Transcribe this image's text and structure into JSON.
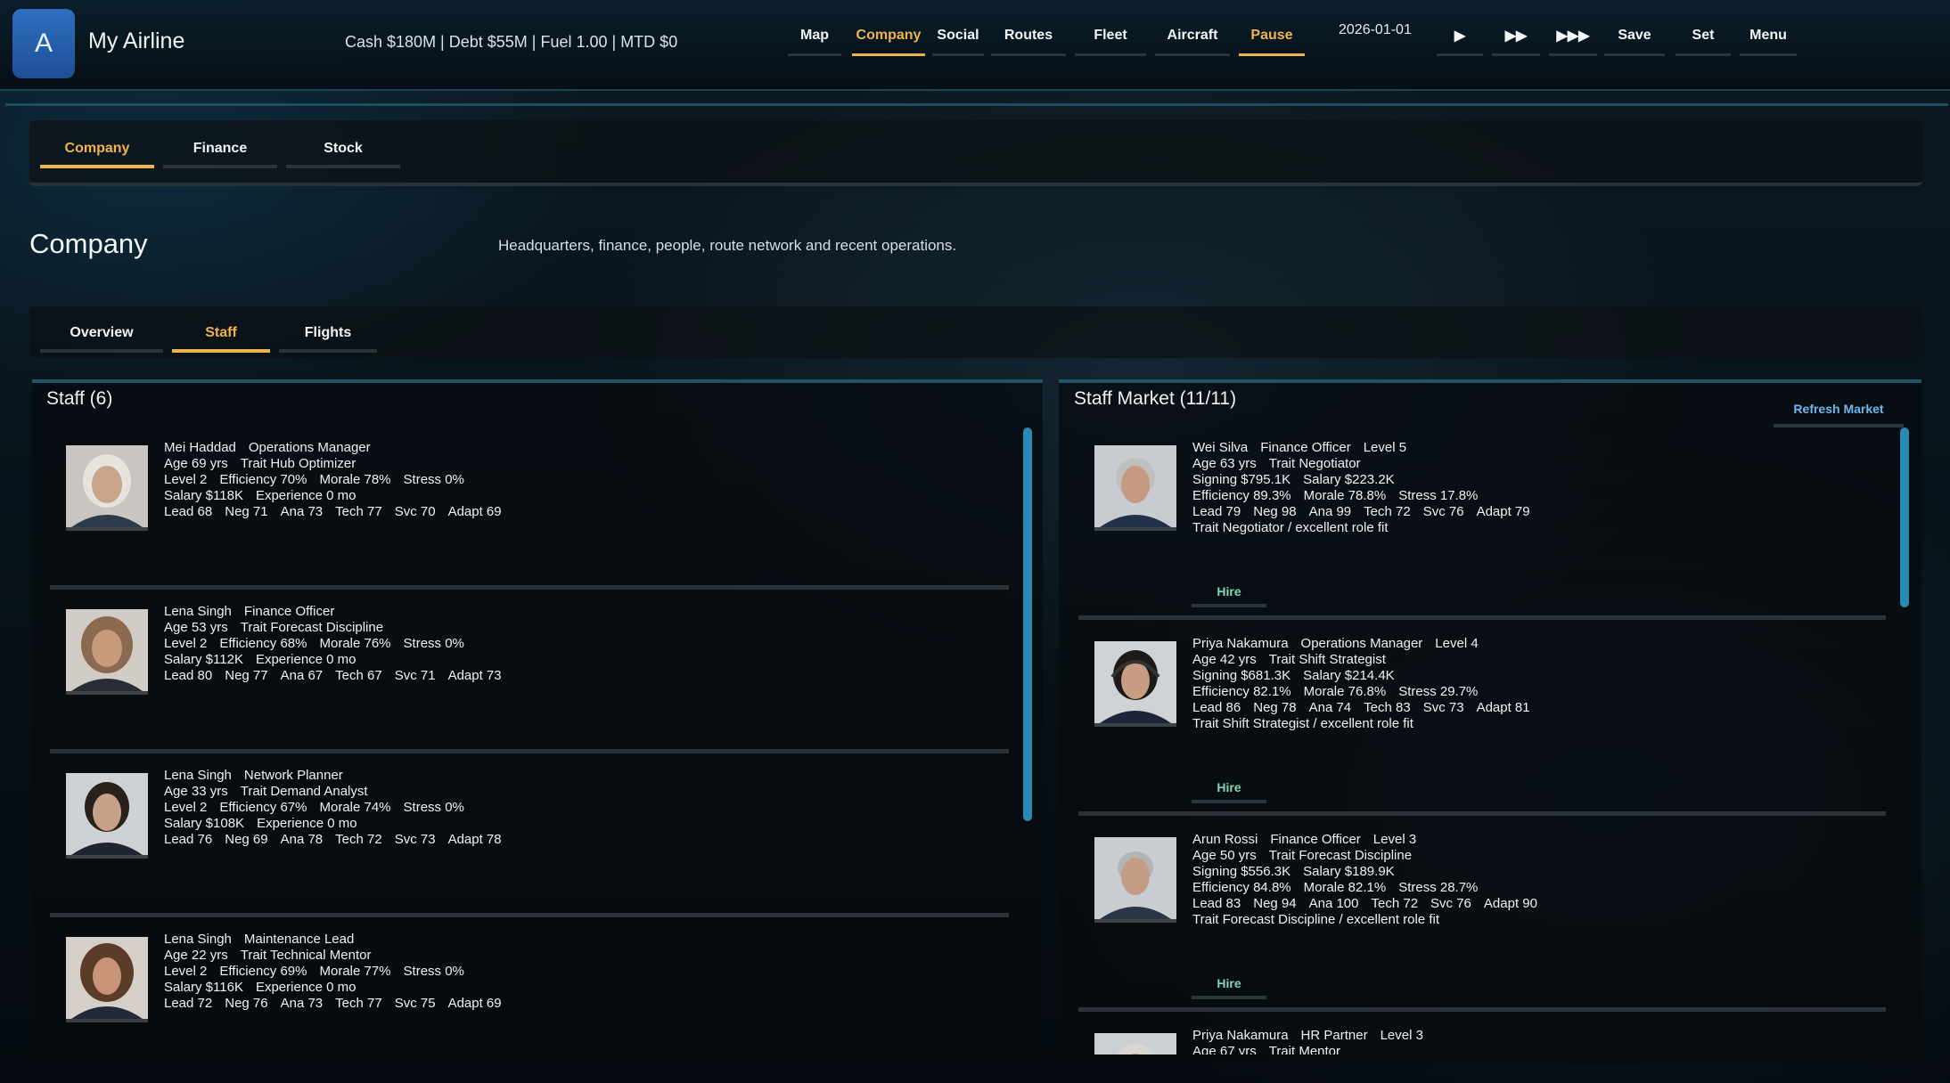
{
  "header": {
    "logo_letter": "A",
    "airline_name": "My Airline",
    "stats": "Cash $180M  |  Debt $55M  |  Fuel 1.00  |  MTD $0",
    "nav": [
      "Map",
      "Company",
      "Social",
      "Routes",
      "Fleet",
      "Aircraft",
      "Pause"
    ],
    "date": "2026-01-01",
    "controls": {
      "play": "▶",
      "fast": "▶▶",
      "fastest": "▶▶▶",
      "save": "Save",
      "set": "Set",
      "menu": "Menu"
    }
  },
  "section_tabs": [
    "Company",
    "Finance",
    "Stock"
  ],
  "page": {
    "title": "Company",
    "description": "Headquarters, finance, people, route network and recent operations."
  },
  "sub_tabs": [
    "Overview",
    "Staff",
    "Flights"
  ],
  "staff": {
    "title": "Staff (6)",
    "members": [
      {
        "name": "Mei Haddad",
        "role": "Operations Manager",
        "age": "Age 69 yrs",
        "trait": "Trait Hub Optimizer",
        "level": "Level 2",
        "efficiency": "Efficiency 70%",
        "morale": "Morale 78%",
        "stress": "Stress 0%",
        "salary": "Salary $118K",
        "experience": "Experience 0 mo",
        "skills": [
          "Lead 68",
          "Neg 71",
          "Ana 73",
          "Tech 77",
          "Svc 70",
          "Adapt 69"
        ]
      },
      {
        "name": "Lena Singh",
        "role": "Finance Officer",
        "age": "Age 53 yrs",
        "trait": "Trait Forecast Discipline",
        "level": "Level 2",
        "efficiency": "Efficiency 68%",
        "morale": "Morale 76%",
        "stress": "Stress 0%",
        "salary": "Salary $112K",
        "experience": "Experience 0 mo",
        "skills": [
          "Lead 80",
          "Neg 77",
          "Ana 67",
          "Tech 67",
          "Svc 71",
          "Adapt 73"
        ]
      },
      {
        "name": "Lena Singh",
        "role": "Network Planner",
        "age": "Age 33 yrs",
        "trait": "Trait Demand Analyst",
        "level": "Level 2",
        "efficiency": "Efficiency 67%",
        "morale": "Morale 74%",
        "stress": "Stress 0%",
        "salary": "Salary $108K",
        "experience": "Experience 0 mo",
        "skills": [
          "Lead 76",
          "Neg 69",
          "Ana 78",
          "Tech 72",
          "Svc 73",
          "Adapt 78"
        ]
      },
      {
        "name": "Lena Singh",
        "role": "Maintenance Lead",
        "age": "Age 22 yrs",
        "trait": "Trait Technical Mentor",
        "level": "Level 2",
        "efficiency": "Efficiency 69%",
        "morale": "Morale 77%",
        "stress": "Stress 0%",
        "salary": "Salary $116K",
        "experience": "Experience 0 mo",
        "skills": [
          "Lead 72",
          "Neg 76",
          "Ana 73",
          "Tech 77",
          "Svc 75",
          "Adapt 69"
        ]
      }
    ]
  },
  "market": {
    "title": "Staff Market (11/11)",
    "refresh_label": "Refresh Market",
    "hire_label": "Hire",
    "candidates": [
      {
        "name": "Wei Silva",
        "role": "Finance Officer",
        "level": "Level 5",
        "age": "Age 63 yrs",
        "trait": "Trait Negotiator",
        "signing": "Signing $795.1K",
        "salary": "Salary $223.2K",
        "efficiency": "Efficiency 89.3%",
        "morale": "Morale 78.8%",
        "stress": "Stress 17.8%",
        "skills": [
          "Lead 79",
          "Neg 98",
          "Ana 99",
          "Tech 72",
          "Svc 76",
          "Adapt 79"
        ],
        "fit": "Trait Negotiator / excellent role fit"
      },
      {
        "name": "Priya Nakamura",
        "role": "Operations Manager",
        "level": "Level 4",
        "age": "Age 42 yrs",
        "trait": "Trait Shift Strategist",
        "signing": "Signing $681.3K",
        "salary": "Salary $214.4K",
        "efficiency": "Efficiency 82.1%",
        "morale": "Morale 76.8%",
        "stress": "Stress 29.7%",
        "skills": [
          "Lead 86",
          "Neg 78",
          "Ana 74",
          "Tech 83",
          "Svc 73",
          "Adapt 81"
        ],
        "fit": "Trait Shift Strategist / excellent role fit"
      },
      {
        "name": "Arun Rossi",
        "role": "Finance Officer",
        "level": "Level 3",
        "age": "Age 50 yrs",
        "trait": "Trait Forecast Discipline",
        "signing": "Signing $556.3K",
        "salary": "Salary $189.9K",
        "efficiency": "Efficiency 84.8%",
        "morale": "Morale 82.1%",
        "stress": "Stress 28.7%",
        "skills": [
          "Lead 83",
          "Neg 94",
          "Ana 100",
          "Tech 72",
          "Svc 76",
          "Adapt 90"
        ],
        "fit": "Trait Forecast Discipline / excellent role fit"
      },
      {
        "name": "Priya Nakamura",
        "role": "HR Partner",
        "level": "Level 3",
        "age": "Age 67 yrs",
        "trait": "Trait Mentor"
      }
    ]
  }
}
